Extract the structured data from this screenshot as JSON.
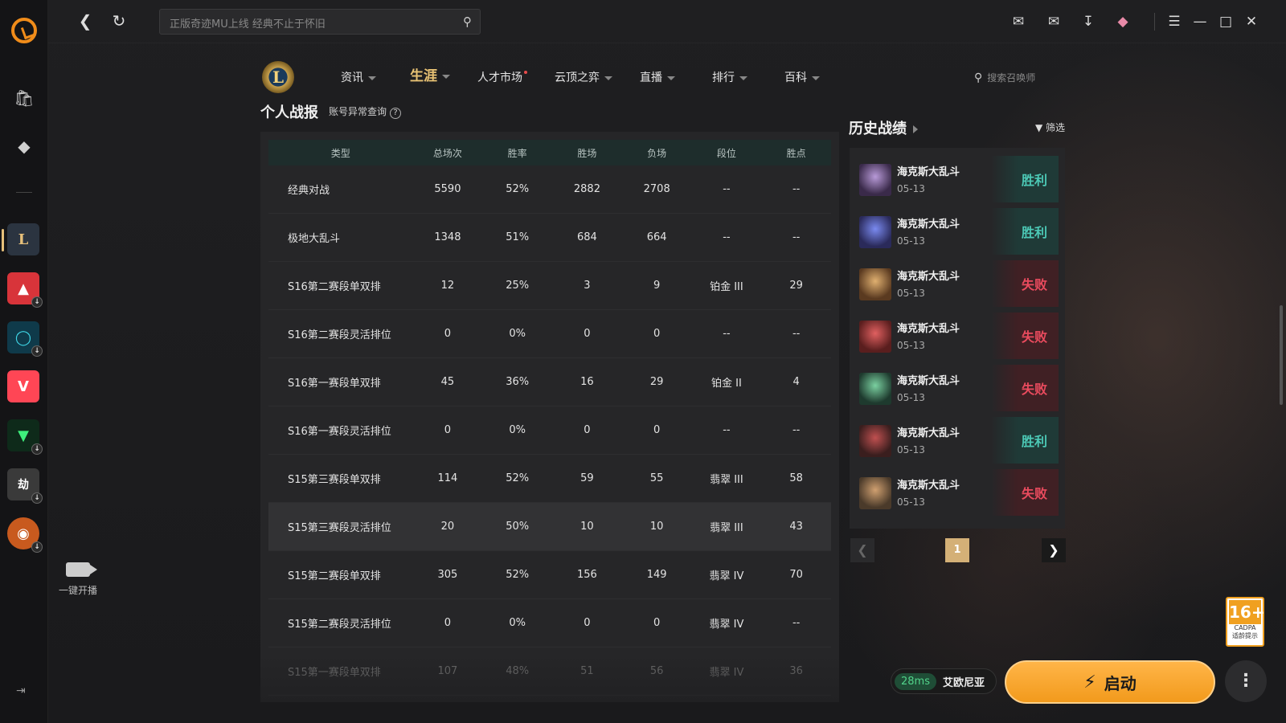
{
  "app": {
    "search_placeholder": "正版奇迹MU上线 经典不止于怀旧"
  },
  "rail": {
    "live_label": "一键开播"
  },
  "game_nav": {
    "logo_text": "L",
    "items": [
      {
        "label": "资讯"
      },
      {
        "label": "生涯"
      },
      {
        "label": "人才市场"
      },
      {
        "label": "云顶之弈"
      },
      {
        "label": "直播"
      },
      {
        "label": "排行"
      },
      {
        "label": "百科"
      }
    ],
    "search_placeholder": "搜索召唤师"
  },
  "stats": {
    "title": "个人战报",
    "anomaly_link": "账号异常查询",
    "anomaly_q": "?",
    "columns": [
      "类型",
      "总场次",
      "胜率",
      "胜场",
      "负场",
      "段位",
      "胜点"
    ],
    "rows": [
      [
        "经典对战",
        "5590",
        "52%",
        "2882",
        "2708",
        "--",
        "--"
      ],
      [
        "极地大乱斗",
        "1348",
        "51%",
        "684",
        "664",
        "--",
        "--"
      ],
      [
        "S16第二赛段单双排",
        "12",
        "25%",
        "3",
        "9",
        "铂金 III",
        "29"
      ],
      [
        "S16第二赛段灵活排位",
        "0",
        "0%",
        "0",
        "0",
        "--",
        "--"
      ],
      [
        "S16第一赛段单双排",
        "45",
        "36%",
        "16",
        "29",
        "铂金 II",
        "4"
      ],
      [
        "S16第一赛段灵活排位",
        "0",
        "0%",
        "0",
        "0",
        "--",
        "--"
      ],
      [
        "S15第三赛段单双排",
        "114",
        "52%",
        "59",
        "55",
        "翡翠 III",
        "58"
      ],
      [
        "S15第三赛段灵活排位",
        "20",
        "50%",
        "10",
        "10",
        "翡翠 III",
        "43"
      ],
      [
        "S15第二赛段单双排",
        "305",
        "52%",
        "156",
        "149",
        "翡翠 IV",
        "70"
      ],
      [
        "S15第二赛段灵活排位",
        "0",
        "0%",
        "0",
        "0",
        "翡翠 IV",
        "--"
      ],
      [
        "S15第一赛段单双排",
        "107",
        "48%",
        "51",
        "56",
        "翡翠 IV",
        "36"
      ]
    ]
  },
  "history": {
    "title": "历史战绩",
    "filter_label": "筛选",
    "items": [
      {
        "mode": "海克斯大乱斗",
        "date": "05-13",
        "result": "胜利",
        "win": true
      },
      {
        "mode": "海克斯大乱斗",
        "date": "05-13",
        "result": "胜利",
        "win": true
      },
      {
        "mode": "海克斯大乱斗",
        "date": "05-13",
        "result": "失败",
        "win": false
      },
      {
        "mode": "海克斯大乱斗",
        "date": "05-13",
        "result": "失败",
        "win": false
      },
      {
        "mode": "海克斯大乱斗",
        "date": "05-13",
        "result": "失败",
        "win": false
      },
      {
        "mode": "海克斯大乱斗",
        "date": "05-13",
        "result": "胜利",
        "win": true
      },
      {
        "mode": "海克斯大乱斗",
        "date": "05-13",
        "result": "失败",
        "win": false
      }
    ],
    "page": "1"
  },
  "footer": {
    "age_rating": "16+",
    "age_sub": "CADPA",
    "age_caption": "适龄提示",
    "ping": "28ms",
    "region": "艾欧尼亚",
    "start_label": "启动"
  },
  "colors": {
    "accent_gold": "#e8c274",
    "win_teal": "#4cc9b6",
    "lose_red": "#ea4b5e",
    "start_orange": "#f29a1c"
  }
}
